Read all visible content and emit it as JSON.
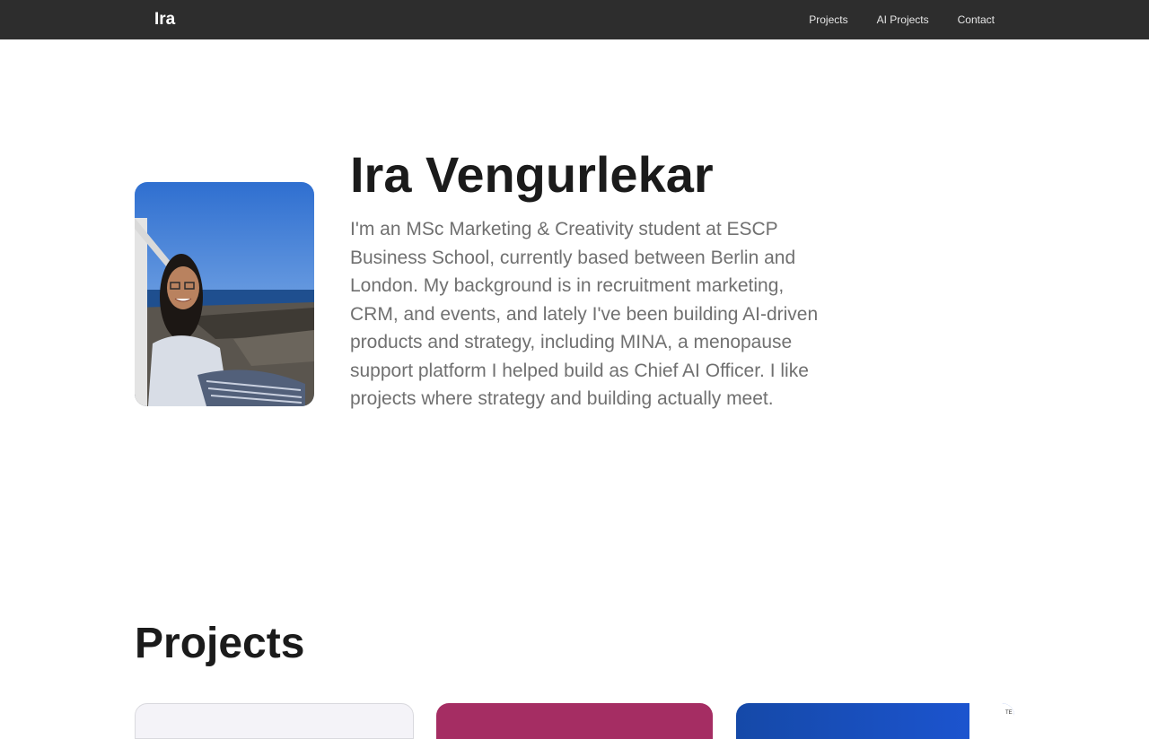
{
  "nav": {
    "brand": "Ira",
    "links": [
      {
        "label": "Projects"
      },
      {
        "label": "AI Projects"
      },
      {
        "label": "Contact"
      }
    ]
  },
  "hero": {
    "name": "Ira Vengurlekar",
    "bio": "I'm an MSc Marketing & Creativity student at ESCP Business School, currently based between Berlin and London. My background is in recruitment marketing, CRM, and events, and lately I've been building AI-driven products and strategy, including MINA, a menopause support platform I helped build as Chief AI Officer. I like projects where strategy and building actually meet."
  },
  "projects": {
    "title": "Projects",
    "cards": [
      {
        "color": "#f4f3f8"
      },
      {
        "color": "#a52d63"
      },
      {
        "color": "#1d56d6",
        "inset_text": "TE"
      }
    ]
  },
  "colors": {
    "navbar": "#2d2d2d",
    "heading": "#1b1b1b",
    "body_text": "#707070"
  }
}
